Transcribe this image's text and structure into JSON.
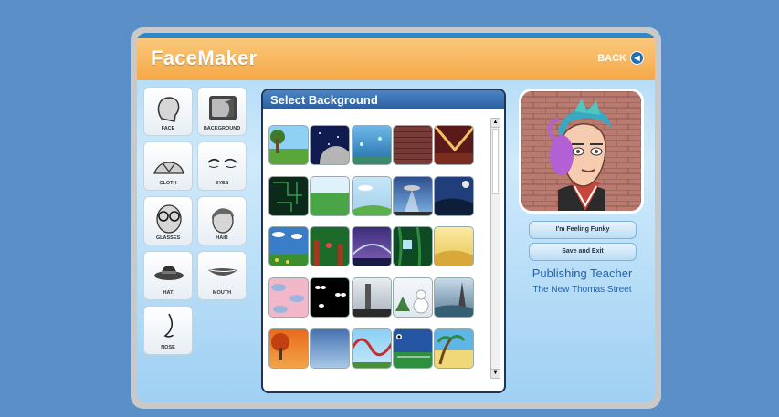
{
  "app": {
    "title": "FaceMaker",
    "back_label": "BACK"
  },
  "tools": [
    {
      "label": "FACE",
      "icon": "face-icon"
    },
    {
      "label": "BACKGROUND",
      "icon": "background-icon"
    },
    {
      "label": "CLOTH",
      "icon": "cloth-icon"
    },
    {
      "label": "EYES",
      "icon": "eyes-icon"
    },
    {
      "label": "GLASSES",
      "icon": "glasses-icon"
    },
    {
      "label": "HAIR",
      "icon": "hair-icon"
    },
    {
      "label": "HAT",
      "icon": "hat-icon"
    },
    {
      "label": "MOUTH",
      "icon": "mouth-icon"
    },
    {
      "label": "NOSE",
      "icon": "nose-icon"
    }
  ],
  "panel": {
    "title": "Select Background"
  },
  "buttons": {
    "funky": "I'm Feeling Funky",
    "save": "Save and Exit"
  },
  "user": {
    "name": "Publishing Teacher",
    "school": "The New Thomas Street"
  },
  "colors": {
    "header_orange": "#f6a847",
    "accent_blue": "#2b5e9f",
    "page_bg": "#5b8fc7"
  }
}
